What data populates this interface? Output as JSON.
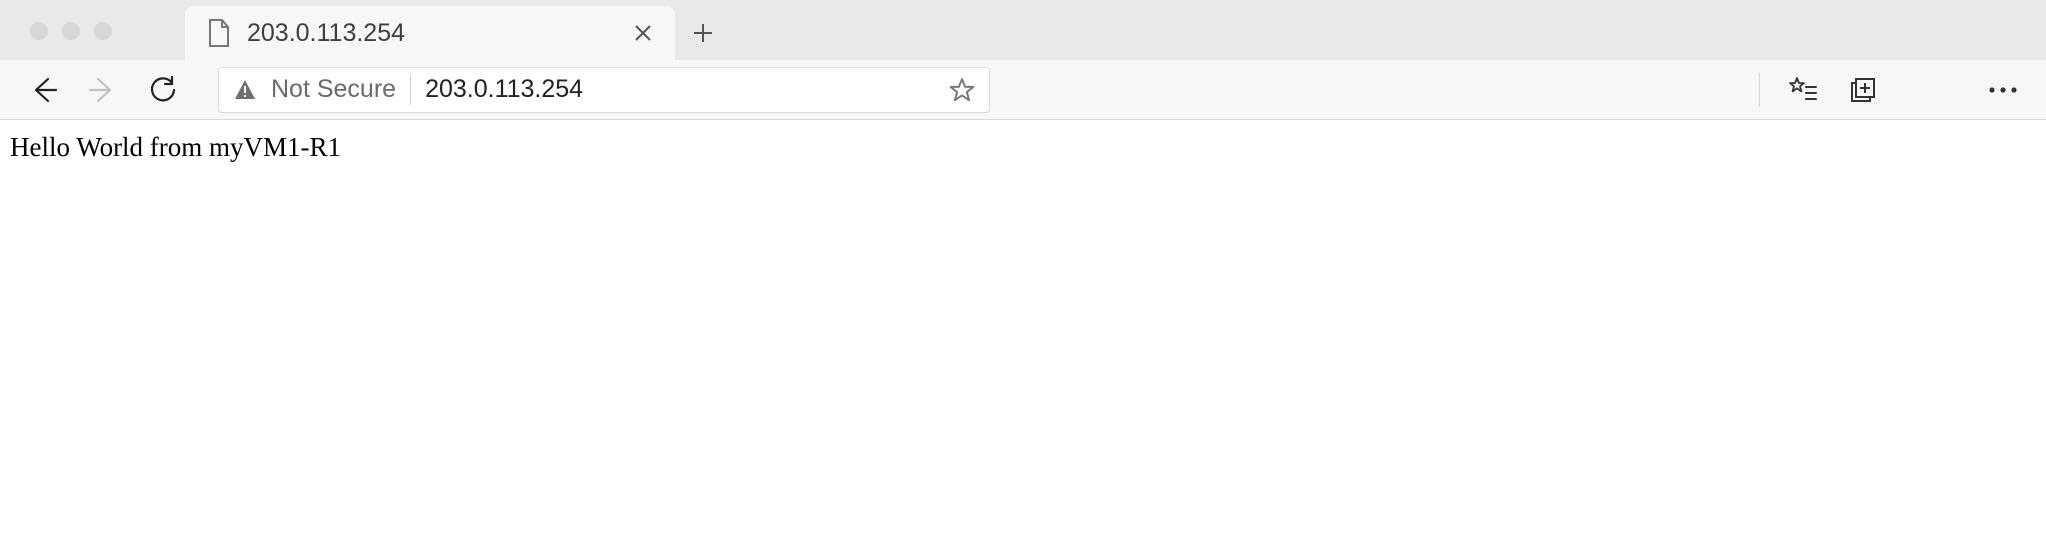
{
  "tab": {
    "title": "203.0.113.254"
  },
  "toolbar": {
    "security_label": "Not Secure",
    "url": "203.0.113.254"
  },
  "page": {
    "body_text": "Hello World from myVM1-R1"
  }
}
